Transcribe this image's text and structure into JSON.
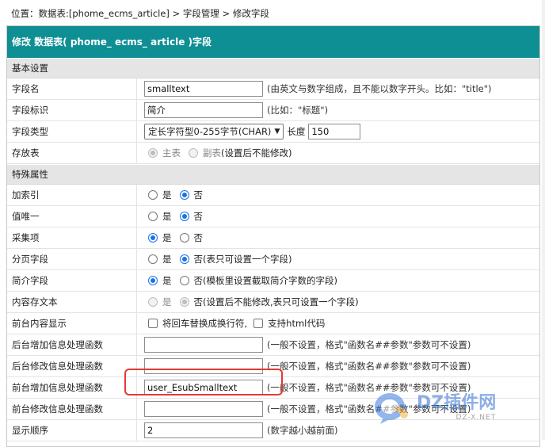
{
  "breadcrumb": {
    "prefix": "位置：",
    "table_link": "数据表:[phome_ecms_article]",
    "sep1": " > ",
    "field_mgmt": "字段管理",
    "sep2": " > ",
    "current": "修改字段"
  },
  "header": {
    "title": "修改 数据表( phome_ ecms_ article )字段"
  },
  "sections": {
    "basic": "基本设置",
    "special": "特殊属性"
  },
  "basic": {
    "field_name": {
      "label": "字段名",
      "value": "smalltext",
      "hint": "(由英文与数字组成，且不能以数字开头。比如：\"title\")"
    },
    "field_title": {
      "label": "字段标识",
      "value": "简介",
      "hint": "(比如：\"标题\")"
    },
    "field_type": {
      "label": "字段类型",
      "selected": "定长字符型0-255字节(CHAR)",
      "length_label": "长度",
      "length_value": "150"
    },
    "storage": {
      "label": "存放表",
      "opt1": "主表",
      "opt2": "副表",
      "note": "(设置后不能修改)"
    }
  },
  "special": {
    "index": {
      "label": "加索引",
      "yes": "是",
      "no": "否"
    },
    "unique": {
      "label": "值唯一",
      "yes": "是",
      "no": "否"
    },
    "collect": {
      "label": "采集项",
      "yes": "是",
      "no": "否"
    },
    "paging": {
      "label": "分页字段",
      "yes": "是",
      "no": "否",
      "note": "(表只可设置一个字段)"
    },
    "summary": {
      "label": "简介字段",
      "yes": "是",
      "no": "否",
      "note": "(模板里设置截取简介字数的字段)"
    },
    "content_store": {
      "label": "内容存文本",
      "yes": "是",
      "no": "否",
      "note": "(设置后不能修改,表只可设置一个字段)"
    },
    "frontend_display": {
      "label": "前台内容显示",
      "opt1": "将回车替换成换行符,",
      "opt2": "支持html代码"
    },
    "admin_add_func": {
      "label": "后台增加信息处理函数",
      "value": "",
      "hint": "(一般不设置，格式\"函数名##参数\"参数可不设置)"
    },
    "admin_edit_func": {
      "label": "后台修改信息处理函数",
      "value": "",
      "hint": "(一般不设置，格式\"函数名##参数\"参数可不设置)"
    },
    "front_add_func": {
      "label": "前台增加信息处理函数",
      "value": "user_EsubSmalltext",
      "hint": "(一般不设置，格式\"函数名##参数\"参数可不设置)"
    },
    "front_edit_func": {
      "label": "前台修改信息处理函数",
      "value": "",
      "hint": "(一般不设置，格式\"函数名##参数\"参数可不设置)"
    },
    "display_order": {
      "label": "显示顺序",
      "value": "2",
      "hint": "(数字越小越前面)"
    }
  },
  "watermark": {
    "brand": "DZ插件网",
    "domain": "DZ-X.NET"
  },
  "colors": {
    "header_bg": "#0e8f94",
    "section_bg": "#e5e5e5",
    "radio_on": "#1a73e8",
    "highlight": "#e53935"
  }
}
